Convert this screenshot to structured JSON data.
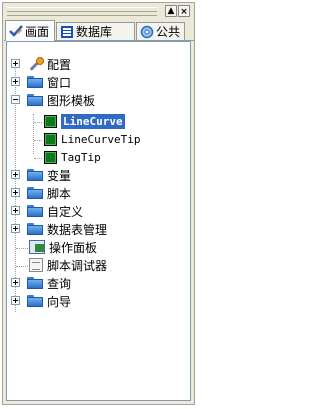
{
  "tabs": [
    {
      "label": "画面",
      "icon": "check-pencil-icon"
    },
    {
      "label": "数据库",
      "icon": "database-icon"
    },
    {
      "label": "公共",
      "icon": "gear-globe-icon"
    }
  ],
  "tree": {
    "items": [
      {
        "label": "配置"
      },
      {
        "label": "窗口"
      },
      {
        "label": "图形模板"
      },
      {
        "label": "LineCurve"
      },
      {
        "label": "LineCurveTip"
      },
      {
        "label": "TagTip"
      },
      {
        "label": "变量"
      },
      {
        "label": "脚本"
      },
      {
        "label": "自定义"
      },
      {
        "label": "数据表管理"
      },
      {
        "label": "操作面板"
      },
      {
        "label": "脚本调试器"
      },
      {
        "label": "查询"
      },
      {
        "label": "向导"
      }
    ]
  },
  "titlebar": {
    "pin": "▲",
    "close": "×"
  }
}
